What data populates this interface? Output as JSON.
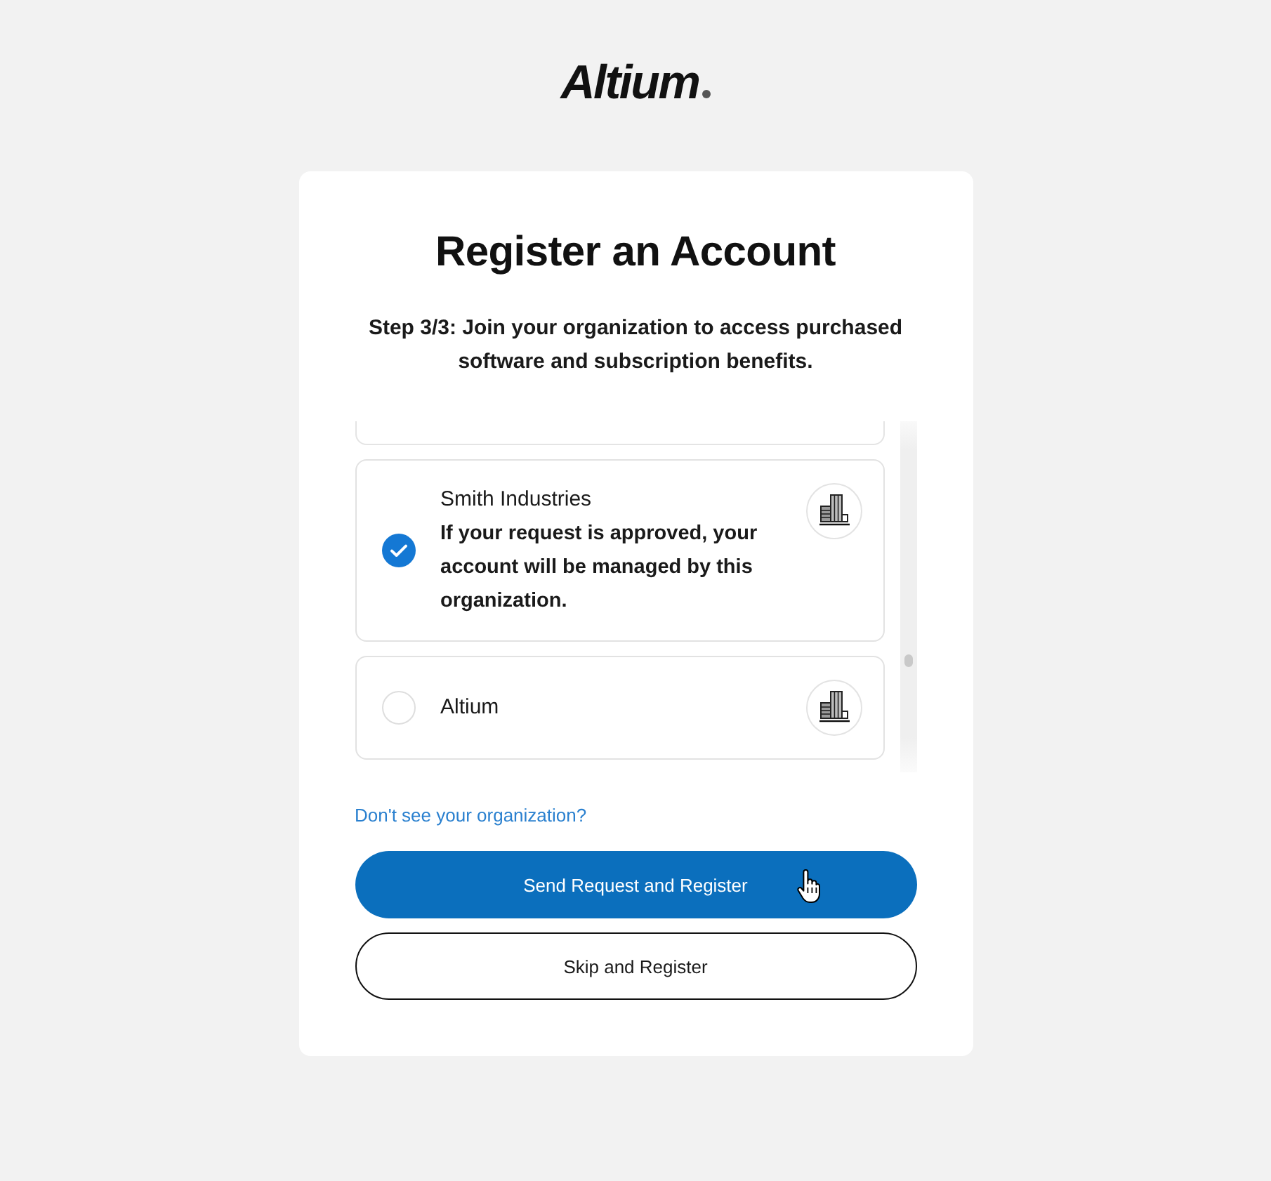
{
  "logo": {
    "text": "Altium"
  },
  "card": {
    "title": "Register an Account",
    "subtitle": "Step 3/3: Join your organization to access purchased software and subscription benefits."
  },
  "organizations": [
    {
      "name": "Smith Industries",
      "selected": true,
      "note": "If your request is approved, your account will be managed by this organization."
    },
    {
      "name": "Altium",
      "selected": false
    }
  ],
  "link": {
    "text": "Don't see your organization?"
  },
  "buttons": [
    {
      "label": "Send Request and Register",
      "kind": "primary"
    },
    {
      "label": "Skip and Register",
      "kind": "secondary"
    }
  ]
}
